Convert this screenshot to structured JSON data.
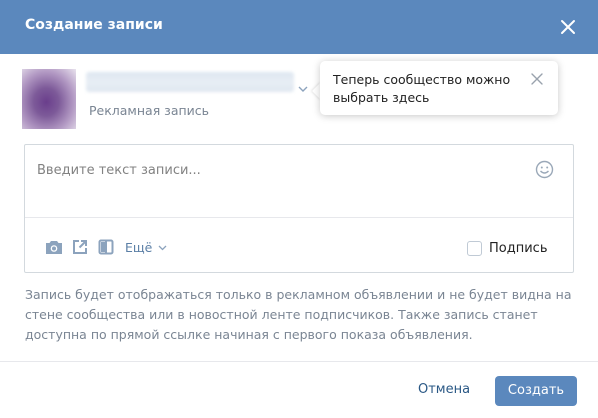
{
  "dialog": {
    "title": "Создание записи"
  },
  "author": {
    "sub_label": "Рекламная запись"
  },
  "tooltip": {
    "text": "Теперь сообщество можно выбрать здесь"
  },
  "composer": {
    "placeholder": "Введите текст записи...",
    "more_label": "Ещё",
    "sign_label": "Подпись",
    "sign_checked": false
  },
  "info_text": "Запись будет отображаться только в рекламном объявлении и не будет видна на стене сообщества или в новостной ленте подписчиков. Также запись станет доступна по прямой ссылке начиная с первого показа объявления.",
  "footer": {
    "cancel_label": "Отмена",
    "create_label": "Создать"
  },
  "colors": {
    "header_bg": "#5b88bd",
    "primary_button": "#5b88bd",
    "link": "#2a5885",
    "muted_text": "#7a8593",
    "icon": "#8ca3bd"
  },
  "icons": [
    "close-icon",
    "chevron-down-icon",
    "smile-icon",
    "camera-icon",
    "share-icon",
    "book-icon"
  ]
}
